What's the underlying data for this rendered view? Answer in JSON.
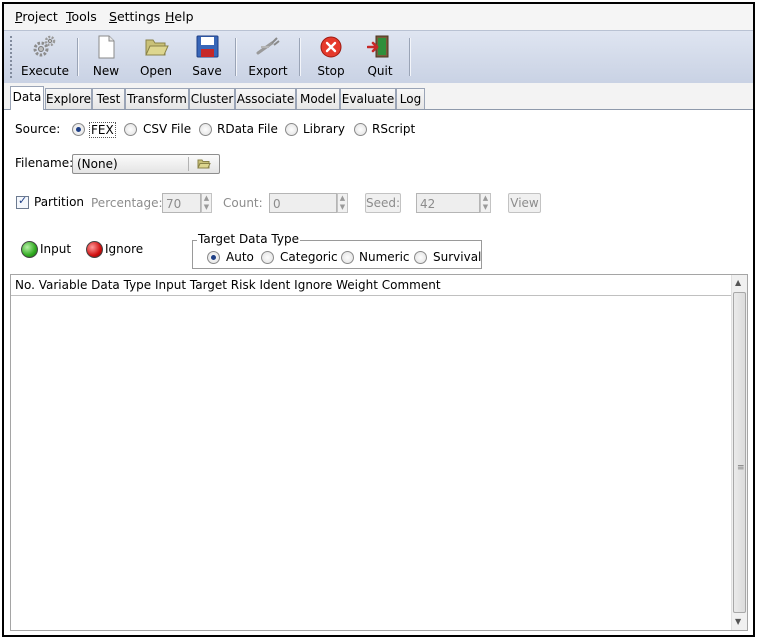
{
  "menubar": {
    "items": [
      {
        "key": "P",
        "rest": "roject"
      },
      {
        "key": "T",
        "rest": "ools"
      },
      {
        "key": "S",
        "rest": "ettings"
      },
      {
        "key": "H",
        "rest": "elp"
      }
    ]
  },
  "toolbar": {
    "execute": "Execute",
    "new": "New",
    "open": "Open",
    "save": "Save",
    "export": "Export",
    "stop": "Stop",
    "quit": "Quit"
  },
  "tabs": [
    "Data",
    "Explore",
    "Test",
    "Transform",
    "Cluster",
    "Associate",
    "Model",
    "Evaluate",
    "Log"
  ],
  "source": {
    "label": "Source:",
    "options": [
      "FEX",
      "CSV File",
      "RData File",
      "Library",
      "RScript"
    ],
    "selected": "FEX"
  },
  "filename": {
    "label": "Filename:",
    "value": "(None)"
  },
  "partition": {
    "label": "Partition",
    "checked": true,
    "percentage_label": "Percentage:",
    "percentage_value": "70",
    "count_label": "Count:",
    "count_value": "0",
    "seed_label": "Seed:",
    "seed_value": "42",
    "view_label": "View"
  },
  "legend": {
    "input_label": "Input",
    "ignore_label": "Ignore",
    "input_color": "#2faa1f",
    "ignore_color": "#d01010"
  },
  "target_type": {
    "title": "Target Data Type",
    "options": [
      "Auto",
      "Categoric",
      "Numeric",
      "Survival"
    ],
    "selected": "Auto"
  },
  "table": {
    "header": "No. Variable Data Type Input Target Risk Ident Ignore Weight Comment"
  }
}
